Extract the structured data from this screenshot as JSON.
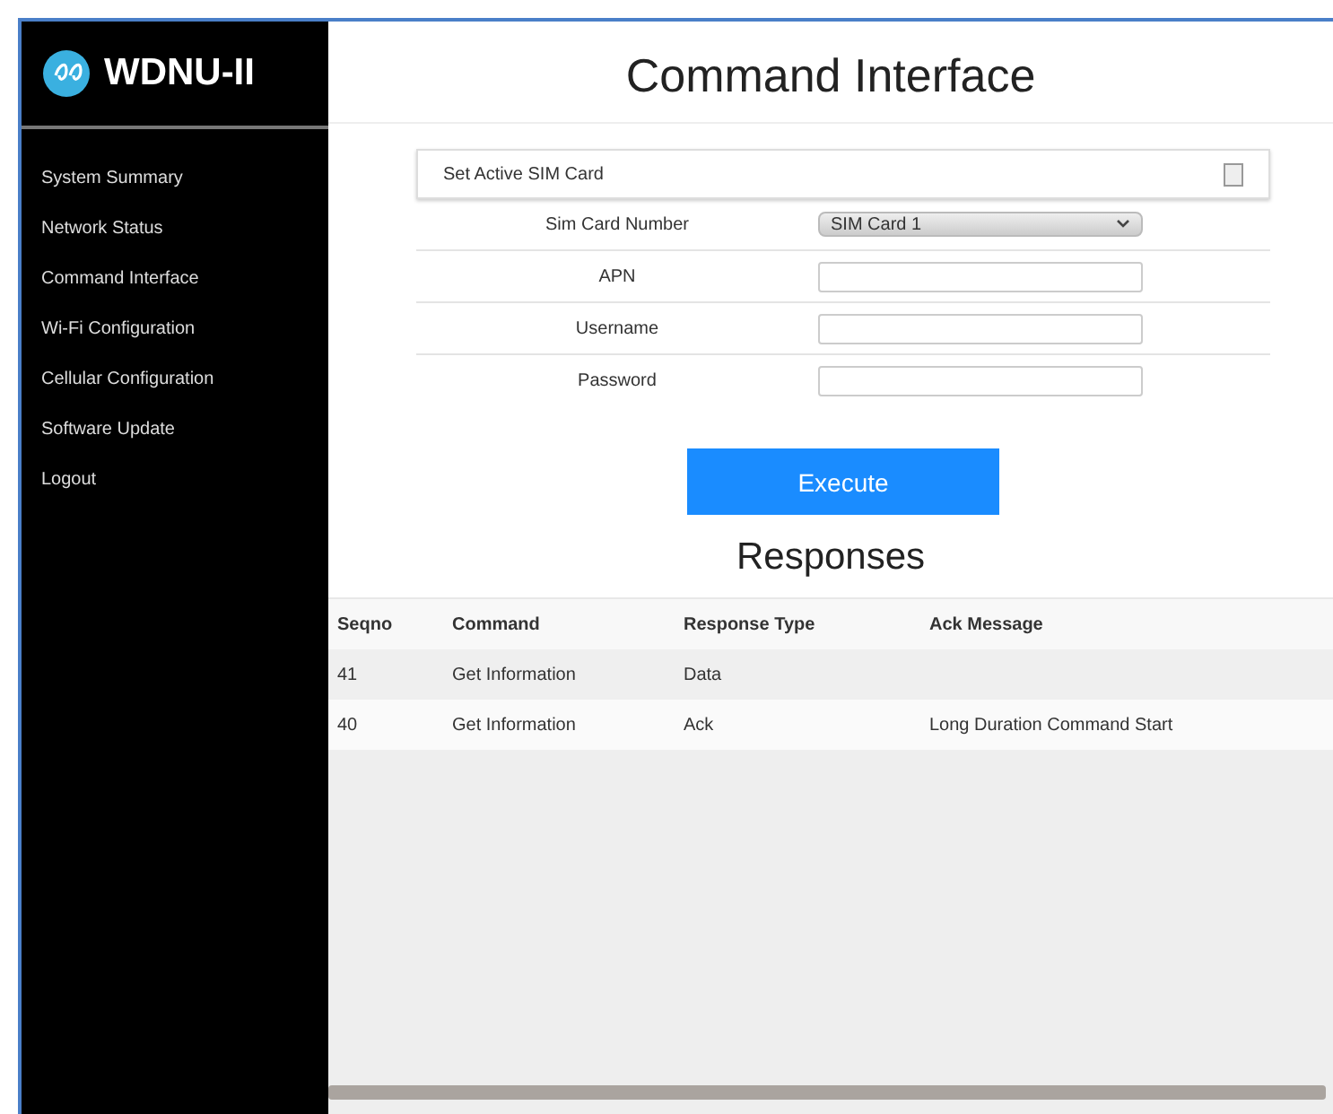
{
  "brand": {
    "name": "WDNU-II"
  },
  "sidebar": {
    "items": [
      {
        "label": "System Summary"
      },
      {
        "label": "Network Status"
      },
      {
        "label": "Command Interface"
      },
      {
        "label": "Wi-Fi Configuration"
      },
      {
        "label": "Cellular Configuration"
      },
      {
        "label": "Software Update"
      },
      {
        "label": "Logout"
      }
    ]
  },
  "page_title": "Command Interface",
  "command_select": {
    "value": "Set Active SIM Card"
  },
  "form": [
    {
      "label": "Sim Card Number",
      "kind": "select",
      "value": "SIM Card 1"
    },
    {
      "label": "APN",
      "kind": "input"
    },
    {
      "label": "Username",
      "kind": "input"
    },
    {
      "label": "Password",
      "kind": "input"
    }
  ],
  "execute_button": "Execute",
  "responses": {
    "title": "Responses",
    "columns": [
      "Seqno",
      "Command",
      "Response Type",
      "Ack Message"
    ],
    "rows": [
      [
        "41",
        "Get Information",
        "Data",
        ""
      ],
      [
        "40",
        "Get Information",
        "Ack",
        "Long Duration Command Start"
      ]
    ]
  }
}
